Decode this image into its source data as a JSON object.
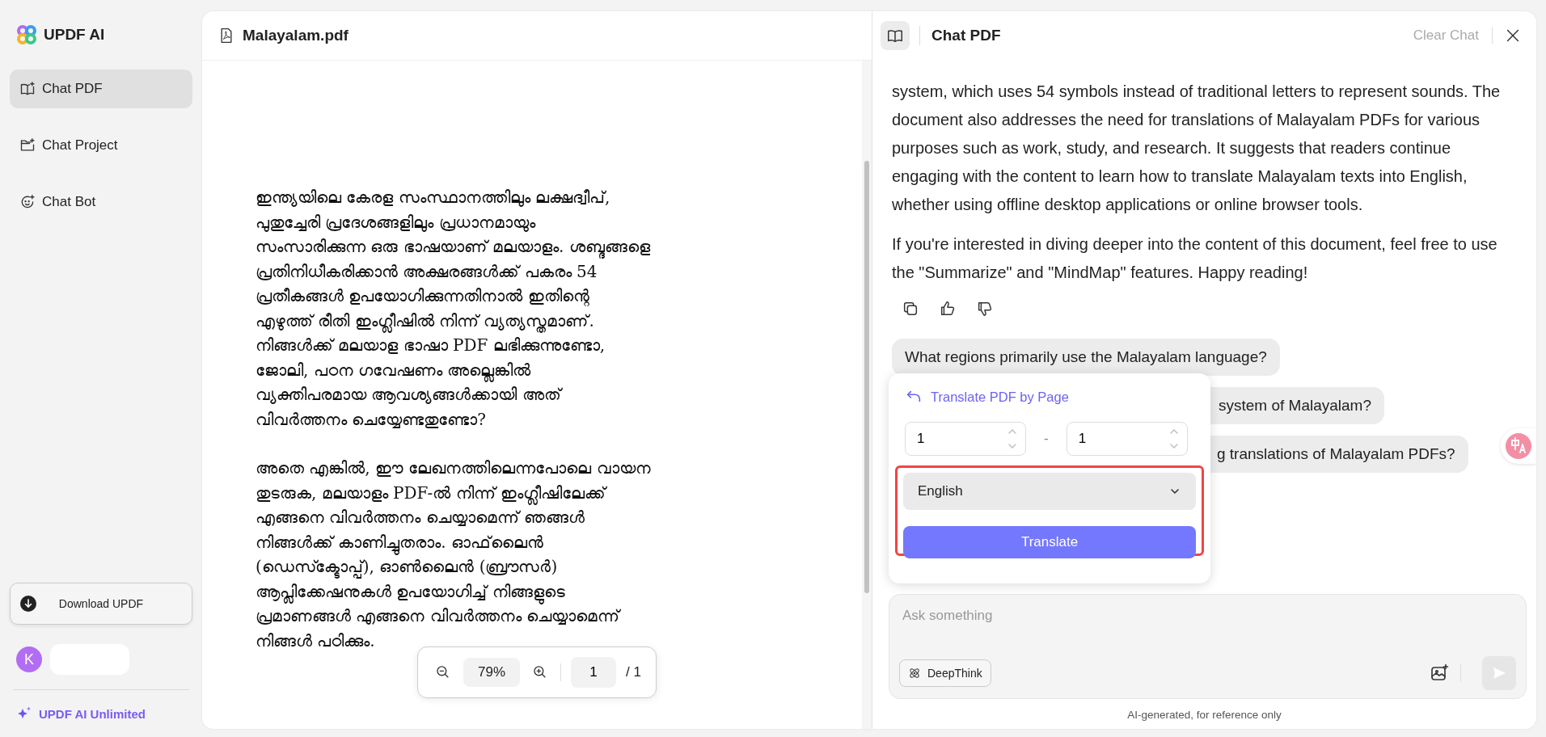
{
  "app": {
    "name": "UPDF AI"
  },
  "sidebar": {
    "items": [
      {
        "label": "Chat PDF",
        "selected": true,
        "kind": "pdf"
      },
      {
        "label": "Chat Project",
        "selected": false,
        "kind": "project"
      },
      {
        "label": "Chat Bot",
        "selected": false,
        "kind": "bot"
      }
    ],
    "download_button": "Download UPDF",
    "user": {
      "initial": "K"
    },
    "upgrade_link": "UPDF AI Unlimited"
  },
  "document": {
    "title": "Malayalam.pdf",
    "paragraphs": [
      [
        "ഇന്ത്യയിലെ കേരള സംസ്ഥാനത്തിലും ലക്ഷദ്വീപ്,",
        "പുതുച്ചേരി പ്രദേശങ്ങളിലും പ്രധാനമായും",
        "സംസാരിക്കുന്ന ഒരു ഭാഷയാണ് മലയാളം. ശബ്ദങ്ങളെ",
        "പ്രതിനിധീകരിക്കാൻ അക്ഷരങ്ങൾക്ക് പകരം 54",
        "പ്രതീകങ്ങൾ ഉപയോഗിക്കുന്നതിനാൽ ഇതിന്റെ",
        "എഴുത്ത് രീതി ഇംഗ്ലീഷിൽ നിന്ന് വ്യത്യസ്തമാണ്.",
        "നിങ്ങൾക്ക് മലയാള ഭാഷാ PDF ലഭിക്കുന്നുണ്ടോ,",
        "ജോലി, പഠന ഗവേഷണം അല്ലെങ്കിൽ",
        "വ്യക്തിപരമായ ആവശ്യങ്ങൾക്കായി അത്",
        "വിവർത്തനം ചെയ്യേണ്ടതുണ്ടോ?"
      ],
      [
        "അതെ എങ്കിൽ, ഈ ലേഖനത്തിലെന്നപോലെ വായന",
        "തുടരുക, മലയാളം PDF-ൽ നിന്ന് ഇംഗ്ലീഷിലേക്ക്",
        "എങ്ങനെ വിവർത്തനം ചെയ്യാമെന്ന് ഞങ്ങൾ",
        "നിങ്ങൾക്ക് കാണിച്ചുതരാം. ഓഫ്‌ലൈൻ",
        "(ഡെസ്ക്ടോപ്പ്), ഓൺലൈൻ (ബ്രൗസർ)",
        "ആപ്ലിക്കേഷനുകൾ ഉപയോഗിച്ച് നിങ്ങളുടെ",
        "പ്രമാണങ്ങൾ എങ്ങനെ വിവർത്തനം ചെയ്യാമെന്ന്",
        "നിങ്ങൾ പഠിക്കും."
      ]
    ],
    "zoom": "79%",
    "page": "1",
    "page_count": "/ 1"
  },
  "chat": {
    "title": "Chat PDF",
    "clear_button": "Clear Chat",
    "answer": [
      "system, which uses 54 symbols instead of traditional letters to represent sounds. The document also addresses the need for translations of Malayalam PDFs for various purposes such as work, study, and research. It suggests that readers continue engaging with the content to learn how to translate Malayalam texts into English, whether using offline desktop applications or online browser tools.",
      "If you're interested in diving deeper into the content of this document, feel free to use the \"Summarize\" and \"MindMap\" features. Happy reading!"
    ],
    "questions": [
      "What regions primarily use the Malayalam language?",
      "system of Malayalam?",
      "g translations of Malayalam PDFs?"
    ],
    "input": {
      "placeholder": "Ask something"
    },
    "deepthink_button": "DeepThink",
    "footer": "AI-generated, for reference only"
  },
  "translate_popup": {
    "title": "Translate PDF by Page",
    "from_page": "1",
    "separator": "-",
    "to_page": "1",
    "language": "English",
    "button": "Translate"
  }
}
